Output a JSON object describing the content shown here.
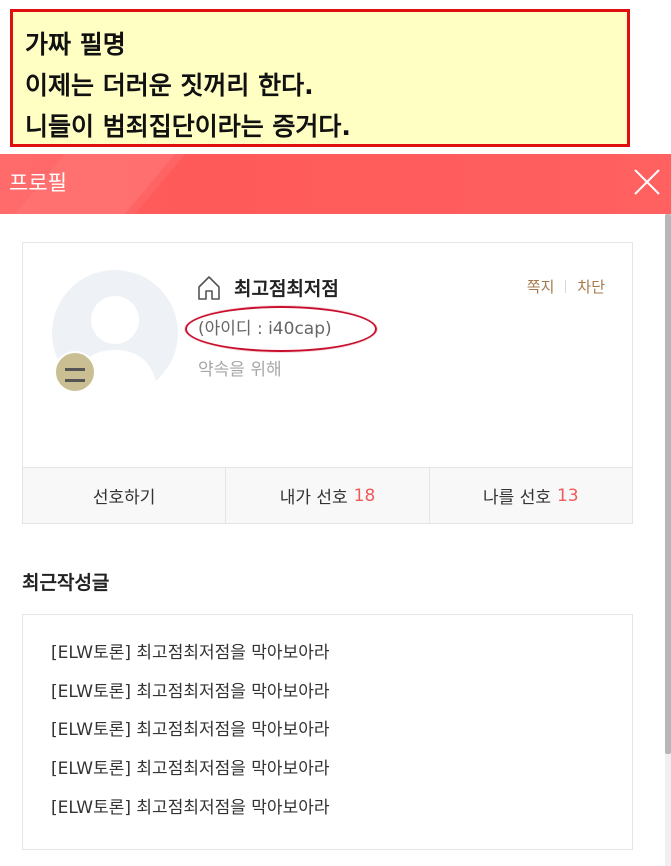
{
  "annotation": {
    "lines": [
      "가짜 필명",
      "이제는 더러운 짓꺼리 한다.",
      "니들이 범죄집단이라는 증거다."
    ]
  },
  "header": {
    "title": "프로필",
    "close_icon": "close-icon"
  },
  "profile": {
    "nickname": "최고점최저점",
    "user_id": "(아이디 : i40cap)",
    "status_message": "약속을 위해",
    "actions": {
      "message": "쪽지",
      "block": "차단"
    },
    "stats": {
      "favorite_label": "선호하기",
      "my_favorites_label": "내가 선호",
      "my_favorites_count": "18",
      "favorited_me_label": "나를 선호",
      "favorited_me_count": "13"
    }
  },
  "recent_posts": {
    "title": "최근작성글",
    "items": [
      "[ELW토론] 최고점최저점을 막아보아라",
      "[ELW토론] 최고점최저점을 막아보아라",
      "[ELW토론] 최고점최저점을 막아보아라",
      "[ELW토론] 최고점최저점을 막아보아라",
      "[ELW토론] 최고점최저점을 막아보아라"
    ]
  },
  "colors": {
    "header_bg": "#ff5e5e",
    "annotation_bg": "#ffffc4",
    "annotation_border": "#e01010",
    "count_accent": "#ef5a5a",
    "action_text": "#a6784a"
  }
}
